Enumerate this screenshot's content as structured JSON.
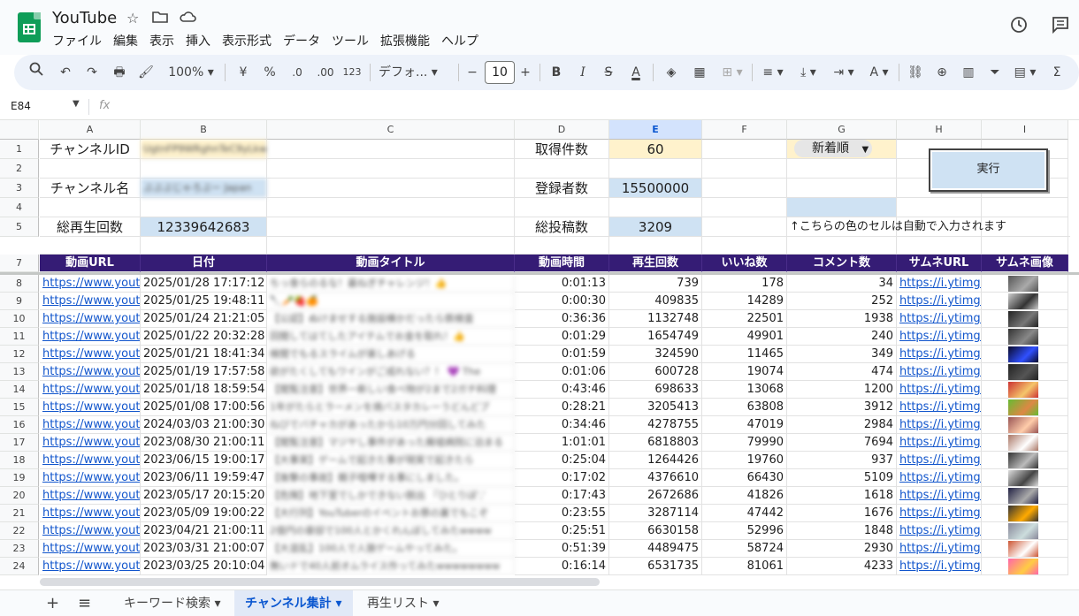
{
  "app": {
    "title": "YouTube"
  },
  "menu": [
    "ファイル",
    "編集",
    "表示",
    "挿入",
    "表示形式",
    "データ",
    "ツール",
    "拡張機能",
    "ヘルプ"
  ],
  "toolbar": {
    "zoom": "100%",
    "currency": "¥",
    "percent": "%",
    "dec_minus": ".0",
    "dec_plus": ".00",
    "format_123": "123",
    "font": "デフォ...",
    "font_size": "10"
  },
  "formula": {
    "name_box": "E84",
    "fx": "fx"
  },
  "columns": [
    "A",
    "B",
    "C",
    "D",
    "E",
    "F",
    "G",
    "H",
    "I"
  ],
  "rows": [
    "1",
    "2",
    "3",
    "4",
    "5",
    "7",
    "8",
    "9",
    "10",
    "11",
    "12",
    "13",
    "14",
    "15",
    "16",
    "17",
    "18",
    "19",
    "20",
    "21",
    "22",
    "23",
    "24"
  ],
  "params": {
    "channel_id_label": "チャンネルID",
    "channel_id_value": "UgtnFP9WRghnTeC9yLkwqw",
    "channel_name_label": "チャンネル名",
    "channel_name_value": "ぶぶぶじゃろぶー Japan",
    "total_views_label": "総再生回数",
    "total_views": "12339642683",
    "fetch_count_label": "取得件数",
    "fetch_count": "60",
    "subs_label": "登録者数",
    "subs": "15500000",
    "posts_label": "総投稿数",
    "posts": "3209",
    "sort_value": "新着順",
    "run_button": "実行",
    "note": "↑こちらの色のセルは自動で入力されます"
  },
  "table": {
    "headers": [
      "動画URL",
      "日付",
      "動画タイトル",
      "動画時間",
      "再生回数",
      "いいね数",
      "コメント数",
      "サムネURL",
      "サムネ画像"
    ],
    "rows": [
      {
        "url": "https://www.youtube",
        "date": "2025/01/28 17:17:12",
        "title": "ちっ食らのるな！最ねぎチャレンジ！👍",
        "dur": "0:01:13",
        "views": "739",
        "likes": "178",
        "comments": "34",
        "thumb": "https://i.ytimg.co"
      },
      {
        "url": "https://www.youtube",
        "date": "2025/01/25 19:48:11",
        "title": "🔪🥕🍓🍊",
        "dur": "0:00:30",
        "views": "409835",
        "likes": "14289",
        "comments": "252",
        "thumb": "https://i.ytimg.co"
      },
      {
        "url": "https://www.youtube",
        "date": "2025/01/24 21:21:05",
        "title": "【公認】ぬけませする施設棟かだったら鉄検査",
        "dur": "0:36:36",
        "views": "1132748",
        "likes": "22501",
        "comments": "1938",
        "thumb": "https://i.ytimg.co"
      },
      {
        "url": "https://www.youtube",
        "date": "2025/01/22 20:32:28",
        "title": "回閲してはてしたアイテムでお金を取れ！👍",
        "dur": "0:01:29",
        "views": "1654749",
        "likes": "49901",
        "comments": "240",
        "thumb": "https://i.ytimg.co"
      },
      {
        "url": "https://www.youtube",
        "date": "2025/01/21 18:41:34",
        "title": "検閲でもるスライムが楽しあげる",
        "dur": "0:01:59",
        "views": "324590",
        "likes": "11465",
        "comments": "349",
        "thumb": "https://i.ytimg.co"
      },
      {
        "url": "https://www.youtube",
        "date": "2025/01/19 17:57:58",
        "title": "欲がたくしてもワインがご成れない？！ 💜 The",
        "dur": "0:01:06",
        "views": "600728",
        "likes": "19074",
        "comments": "474",
        "thumb": "https://i.ytimg.co"
      },
      {
        "url": "https://www.youtube",
        "date": "2025/01/18 18:59:54",
        "title": "【閲覧注意】世界一新しい食べ物が2まで2ガチ料理",
        "dur": "0:43:46",
        "views": "698633",
        "likes": "13068",
        "comments": "1200",
        "thumb": "https://i.ytimg.co"
      },
      {
        "url": "https://www.youtube",
        "date": "2025/01/08 17:00:56",
        "title": "1年がたらとラーメンを焼バスタカレーうどんどプ",
        "dur": "0:28:21",
        "views": "3205413",
        "likes": "63808",
        "comments": "3912",
        "thumb": "https://i.ytimg.co"
      },
      {
        "url": "https://www.youtube",
        "date": "2024/03/03 21:00:30",
        "title": "ねびでバチャカがあったから10万円分回してみた",
        "dur": "0:34:46",
        "views": "4278755",
        "likes": "47019",
        "comments": "2984",
        "thumb": "https://i.ytimg.co"
      },
      {
        "url": "https://www.youtube",
        "date": "2023/08/30 21:00:11",
        "title": "【閲覧注意】マジヤし事件があった廃墟病院に泊まる",
        "dur": "1:01:01",
        "views": "6818803",
        "likes": "79990",
        "comments": "7694",
        "thumb": "https://i.ytimg.co"
      },
      {
        "url": "https://www.youtube",
        "date": "2023/06/15 19:00:17",
        "title": "【大事実】ゲームで起きた事が現実で起きたら",
        "dur": "0:25:04",
        "views": "1264426",
        "likes": "19760",
        "comments": "937",
        "thumb": "https://i.ytimg.co"
      },
      {
        "url": "https://www.youtube",
        "date": "2023/06/11 19:59:47",
        "title": "【後撃の事故】親子喧嘩する事にしました。",
        "dur": "0:17:02",
        "views": "4376610",
        "likes": "66430",
        "comments": "5109",
        "thumb": "https://i.ytimg.co"
      },
      {
        "url": "https://www.youtube",
        "date": "2023/05/17 20:15:20",
        "title": "【危険】地下室でしかできない脱出 『ひとりぼ','",
        "dur": "0:17:43",
        "views": "2672686",
        "likes": "41826",
        "comments": "1618",
        "thumb": "https://i.ytimg.co"
      },
      {
        "url": "https://www.youtube",
        "date": "2023/05/09 19:00:22",
        "title": "【大行列】YouTuberのイベントお祭の裏でもこぞ",
        "dur": "0:23:55",
        "views": "3287114",
        "likes": "47442",
        "comments": "1676",
        "thumb": "https://i.ytimg.co"
      },
      {
        "url": "https://www.youtube",
        "date": "2023/04/21 21:00:11",
        "title": "2億円の豪邸で100人とかくれんぼしてみたwwww",
        "dur": "0:25:51",
        "views": "6630158",
        "likes": "52996",
        "comments": "1848",
        "thumb": "https://i.ytimg.co"
      },
      {
        "url": "https://www.youtube",
        "date": "2023/03/31 21:00:07",
        "title": "【大混乱】100人で人狼ゲームやってみた。",
        "dur": "0:51:39",
        "views": "4489475",
        "likes": "58724",
        "comments": "2930",
        "thumb": "https://i.ytimg.co"
      },
      {
        "url": "https://www.youtube",
        "date": "2023/03/25 20:10:04",
        "title": "無いドで40人前オムライス作ってみたwwwwwwww",
        "dur": "0:16:14",
        "views": "6531735",
        "likes": "81061",
        "comments": "4233",
        "thumb": "https://i.ytimg.co"
      }
    ]
  },
  "tabs": {
    "sheet1": "キーワード検索",
    "sheet2": "チャンネル集計",
    "sheet3": "再生リスト"
  },
  "colors": {
    "header_purple": "#351c75",
    "input_yellow": "#fff2cc",
    "auto_blue": "#cfe2f3",
    "link": "#1155cc"
  }
}
